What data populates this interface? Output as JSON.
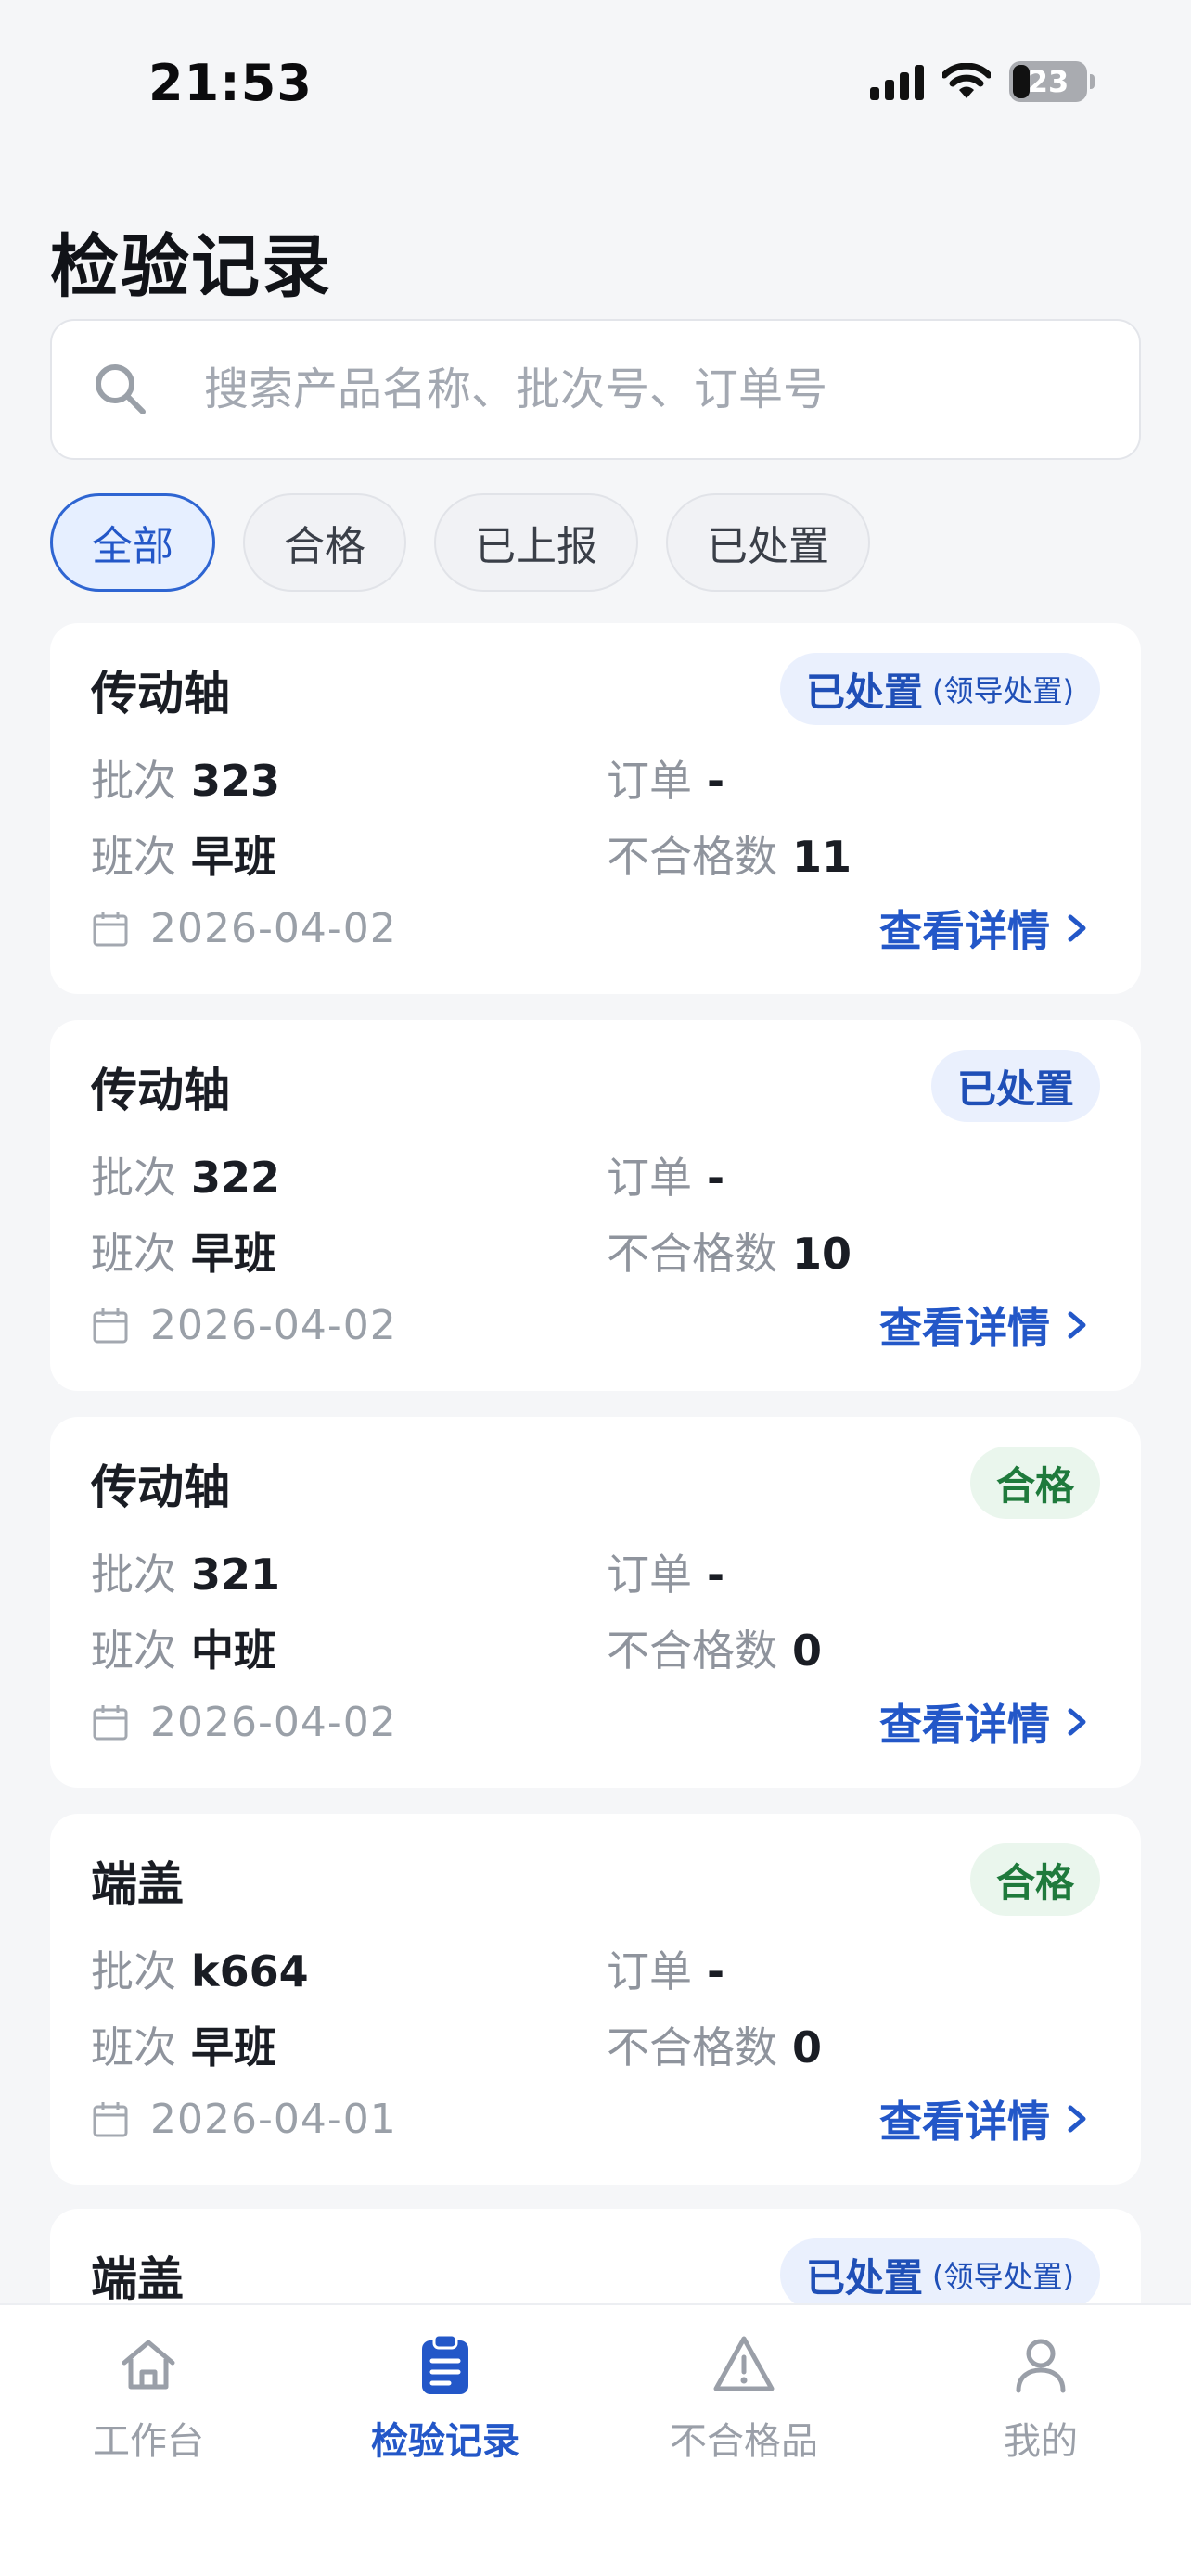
{
  "status": {
    "time": "21:53",
    "battery": "23"
  },
  "page": {
    "title": "检验记录"
  },
  "search": {
    "placeholder": "搜索产品名称、批次号、订单号"
  },
  "filters": [
    {
      "label": "全部",
      "active": true
    },
    {
      "label": "合格",
      "active": false
    },
    {
      "label": "已上报",
      "active": false
    },
    {
      "label": "已处置",
      "active": false
    }
  ],
  "labels": {
    "batch": "批次",
    "order": "订单",
    "shift": "班次",
    "defect_count": "不合格数",
    "view_detail": "查看详情"
  },
  "records": [
    {
      "product": "传动轴",
      "status": "已处置",
      "status_note": "(领导处置)",
      "status_color": "blue",
      "batch": "323",
      "order": "-",
      "shift": "早班",
      "defect_count": "11",
      "date": "2026-04-02"
    },
    {
      "product": "传动轴",
      "status": "已处置",
      "status_note": "",
      "status_color": "blue",
      "batch": "322",
      "order": "-",
      "shift": "早班",
      "defect_count": "10",
      "date": "2026-04-02"
    },
    {
      "product": "传动轴",
      "status": "合格",
      "status_note": "",
      "status_color": "green",
      "batch": "321",
      "order": "-",
      "shift": "中班",
      "defect_count": "0",
      "date": "2026-04-02"
    },
    {
      "product": "端盖",
      "status": "合格",
      "status_note": "",
      "status_color": "green",
      "batch": "k664",
      "order": "-",
      "shift": "早班",
      "defect_count": "0",
      "date": "2026-04-01"
    },
    {
      "product": "端盖",
      "status": "已处置",
      "status_note": "(领导处置)",
      "status_color": "blue"
    }
  ],
  "nav": [
    {
      "label": "工作台",
      "icon": "home-icon",
      "active": false
    },
    {
      "label": "检验记录",
      "icon": "clipboard-icon",
      "active": true
    },
    {
      "label": "不合格品",
      "icon": "warning-icon",
      "active": false
    },
    {
      "label": "我的",
      "icon": "user-icon",
      "active": false
    }
  ],
  "colors": {
    "accent": "#2357c8",
    "success": "#1f7a3c",
    "background": "#f5f6f8"
  }
}
